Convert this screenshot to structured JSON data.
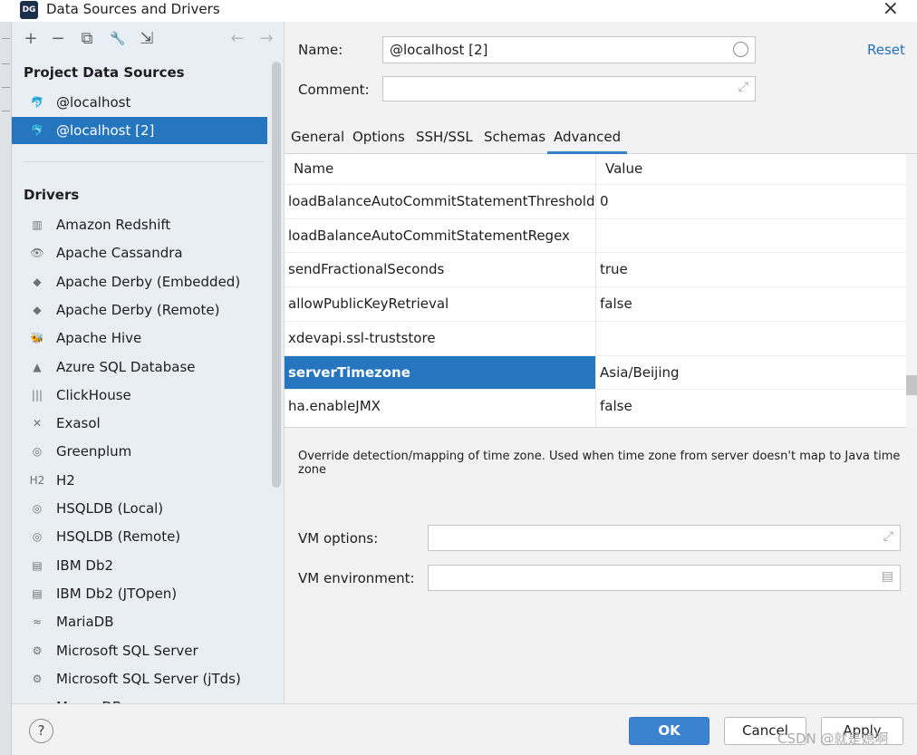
{
  "window": {
    "title": "Data Sources and Drivers",
    "app_icon": "DG",
    "close_icon": "×"
  },
  "toolbar": {
    "add": "+",
    "remove": "−",
    "duplicate": "⧉",
    "settings": "🔧",
    "import": "⇲",
    "back": "←",
    "forward": "→"
  },
  "sidebar": {
    "project_header": "Project Data Sources",
    "data_sources": [
      {
        "label": "@localhost",
        "icon": "mysql-dolphin-icon"
      },
      {
        "label": "@localhost [2]",
        "icon": "mysql-dolphin-icon",
        "selected": true
      }
    ],
    "drivers_header": "Drivers",
    "drivers": [
      {
        "label": "Amazon Redshift",
        "glyph": "▥"
      },
      {
        "label": "Apache Cassandra",
        "glyph": "👁"
      },
      {
        "label": "Apache Derby (Embedded)",
        "glyph": "◆"
      },
      {
        "label": "Apache Derby (Remote)",
        "glyph": "◆"
      },
      {
        "label": "Apache Hive",
        "glyph": "🐝"
      },
      {
        "label": "Azure SQL Database",
        "glyph": "▲"
      },
      {
        "label": "ClickHouse",
        "glyph": "|||"
      },
      {
        "label": "Exasol",
        "glyph": "✕"
      },
      {
        "label": "Greenplum",
        "glyph": "◎"
      },
      {
        "label": "H2",
        "glyph": "H2"
      },
      {
        "label": "HSQLDB (Local)",
        "glyph": "◎"
      },
      {
        "label": "HSQLDB (Remote)",
        "glyph": "◎"
      },
      {
        "label": "IBM Db2",
        "glyph": "▤"
      },
      {
        "label": "IBM Db2 (JTOpen)",
        "glyph": "▤"
      },
      {
        "label": "MariaDB",
        "glyph": "≈"
      },
      {
        "label": "Microsoft SQL Server",
        "glyph": "⚙"
      },
      {
        "label": "Microsoft SQL Server (jTds)",
        "glyph": "⚙"
      },
      {
        "label": "MongoDB",
        "glyph": "▲"
      }
    ]
  },
  "form": {
    "name_label": "Name:",
    "name_value": "@localhost [2]",
    "comment_label": "Comment:",
    "comment_value": "",
    "reset": "Reset",
    "expand_icon": "⤢"
  },
  "tabs": [
    {
      "label": "General"
    },
    {
      "label": "Options"
    },
    {
      "label": "SSH/SSL"
    },
    {
      "label": "Schemas"
    },
    {
      "label": "Advanced",
      "active": true
    }
  ],
  "properties": {
    "headers": {
      "name": "Name",
      "value": "Value"
    },
    "rows": [
      {
        "name": "loadBalanceAutoCommitStatementThreshold",
        "value": "0"
      },
      {
        "name": "loadBalanceAutoCommitStatementRegex",
        "value": ""
      },
      {
        "name": "sendFractionalSeconds",
        "value": "true"
      },
      {
        "name": "allowPublicKeyRetrieval",
        "value": "false"
      },
      {
        "name": "xdevapi.ssl-truststore",
        "value": ""
      },
      {
        "name": "serverTimezone",
        "value": "Asia/Beijing",
        "selected": true
      },
      {
        "name": "ha.enableJMX",
        "value": "false"
      }
    ]
  },
  "description": "Override detection/mapping of time zone. Used when time zone from server doesn't map to Java time zone",
  "vm": {
    "options_label": "VM options:",
    "options_value": "",
    "env_label": "VM environment:",
    "env_value": "",
    "doc_icon": "▤"
  },
  "buttons": {
    "help": "?",
    "ok": "OK",
    "cancel": "Cancel",
    "apply": "Apply"
  },
  "watermark": "CSDN @就是媳啊",
  "colors": {
    "accent": "#2675bf",
    "link": "#2470b8"
  }
}
